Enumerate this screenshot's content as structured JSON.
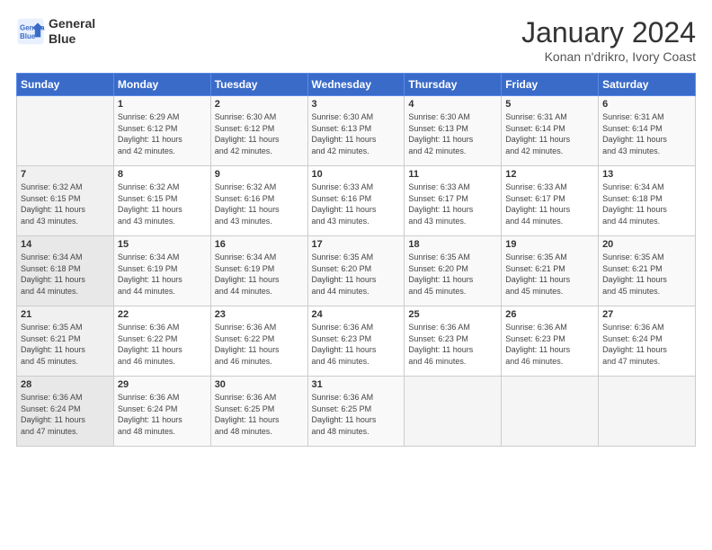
{
  "header": {
    "logo_line1": "General",
    "logo_line2": "Blue",
    "title": "January 2024",
    "subtitle": "Konan n'drikro, Ivory Coast"
  },
  "days_of_week": [
    "Sunday",
    "Monday",
    "Tuesday",
    "Wednesday",
    "Thursday",
    "Friday",
    "Saturday"
  ],
  "weeks": [
    [
      {
        "day": "",
        "info": ""
      },
      {
        "day": "1",
        "info": "Sunrise: 6:29 AM\nSunset: 6:12 PM\nDaylight: 11 hours\nand 42 minutes."
      },
      {
        "day": "2",
        "info": "Sunrise: 6:30 AM\nSunset: 6:12 PM\nDaylight: 11 hours\nand 42 minutes."
      },
      {
        "day": "3",
        "info": "Sunrise: 6:30 AM\nSunset: 6:13 PM\nDaylight: 11 hours\nand 42 minutes."
      },
      {
        "day": "4",
        "info": "Sunrise: 6:30 AM\nSunset: 6:13 PM\nDaylight: 11 hours\nand 42 minutes."
      },
      {
        "day": "5",
        "info": "Sunrise: 6:31 AM\nSunset: 6:14 PM\nDaylight: 11 hours\nand 42 minutes."
      },
      {
        "day": "6",
        "info": "Sunrise: 6:31 AM\nSunset: 6:14 PM\nDaylight: 11 hours\nand 43 minutes."
      }
    ],
    [
      {
        "day": "7",
        "info": "Sunrise: 6:32 AM\nSunset: 6:15 PM\nDaylight: 11 hours\nand 43 minutes."
      },
      {
        "day": "8",
        "info": "Sunrise: 6:32 AM\nSunset: 6:15 PM\nDaylight: 11 hours\nand 43 minutes."
      },
      {
        "day": "9",
        "info": "Sunrise: 6:32 AM\nSunset: 6:16 PM\nDaylight: 11 hours\nand 43 minutes."
      },
      {
        "day": "10",
        "info": "Sunrise: 6:33 AM\nSunset: 6:16 PM\nDaylight: 11 hours\nand 43 minutes."
      },
      {
        "day": "11",
        "info": "Sunrise: 6:33 AM\nSunset: 6:17 PM\nDaylight: 11 hours\nand 43 minutes."
      },
      {
        "day": "12",
        "info": "Sunrise: 6:33 AM\nSunset: 6:17 PM\nDaylight: 11 hours\nand 44 minutes."
      },
      {
        "day": "13",
        "info": "Sunrise: 6:34 AM\nSunset: 6:18 PM\nDaylight: 11 hours\nand 44 minutes."
      }
    ],
    [
      {
        "day": "14",
        "info": "Sunrise: 6:34 AM\nSunset: 6:18 PM\nDaylight: 11 hours\nand 44 minutes."
      },
      {
        "day": "15",
        "info": "Sunrise: 6:34 AM\nSunset: 6:19 PM\nDaylight: 11 hours\nand 44 minutes."
      },
      {
        "day": "16",
        "info": "Sunrise: 6:34 AM\nSunset: 6:19 PM\nDaylight: 11 hours\nand 44 minutes."
      },
      {
        "day": "17",
        "info": "Sunrise: 6:35 AM\nSunset: 6:20 PM\nDaylight: 11 hours\nand 44 minutes."
      },
      {
        "day": "18",
        "info": "Sunrise: 6:35 AM\nSunset: 6:20 PM\nDaylight: 11 hours\nand 45 minutes."
      },
      {
        "day": "19",
        "info": "Sunrise: 6:35 AM\nSunset: 6:21 PM\nDaylight: 11 hours\nand 45 minutes."
      },
      {
        "day": "20",
        "info": "Sunrise: 6:35 AM\nSunset: 6:21 PM\nDaylight: 11 hours\nand 45 minutes."
      }
    ],
    [
      {
        "day": "21",
        "info": "Sunrise: 6:35 AM\nSunset: 6:21 PM\nDaylight: 11 hours\nand 45 minutes."
      },
      {
        "day": "22",
        "info": "Sunrise: 6:36 AM\nSunset: 6:22 PM\nDaylight: 11 hours\nand 46 minutes."
      },
      {
        "day": "23",
        "info": "Sunrise: 6:36 AM\nSunset: 6:22 PM\nDaylight: 11 hours\nand 46 minutes."
      },
      {
        "day": "24",
        "info": "Sunrise: 6:36 AM\nSunset: 6:23 PM\nDaylight: 11 hours\nand 46 minutes."
      },
      {
        "day": "25",
        "info": "Sunrise: 6:36 AM\nSunset: 6:23 PM\nDaylight: 11 hours\nand 46 minutes."
      },
      {
        "day": "26",
        "info": "Sunrise: 6:36 AM\nSunset: 6:23 PM\nDaylight: 11 hours\nand 46 minutes."
      },
      {
        "day": "27",
        "info": "Sunrise: 6:36 AM\nSunset: 6:24 PM\nDaylight: 11 hours\nand 47 minutes."
      }
    ],
    [
      {
        "day": "28",
        "info": "Sunrise: 6:36 AM\nSunset: 6:24 PM\nDaylight: 11 hours\nand 47 minutes."
      },
      {
        "day": "29",
        "info": "Sunrise: 6:36 AM\nSunset: 6:24 PM\nDaylight: 11 hours\nand 48 minutes."
      },
      {
        "day": "30",
        "info": "Sunrise: 6:36 AM\nSunset: 6:25 PM\nDaylight: 11 hours\nand 48 minutes."
      },
      {
        "day": "31",
        "info": "Sunrise: 6:36 AM\nSunset: 6:25 PM\nDaylight: 11 hours\nand 48 minutes."
      },
      {
        "day": "",
        "info": ""
      },
      {
        "day": "",
        "info": ""
      },
      {
        "day": "",
        "info": ""
      }
    ]
  ]
}
